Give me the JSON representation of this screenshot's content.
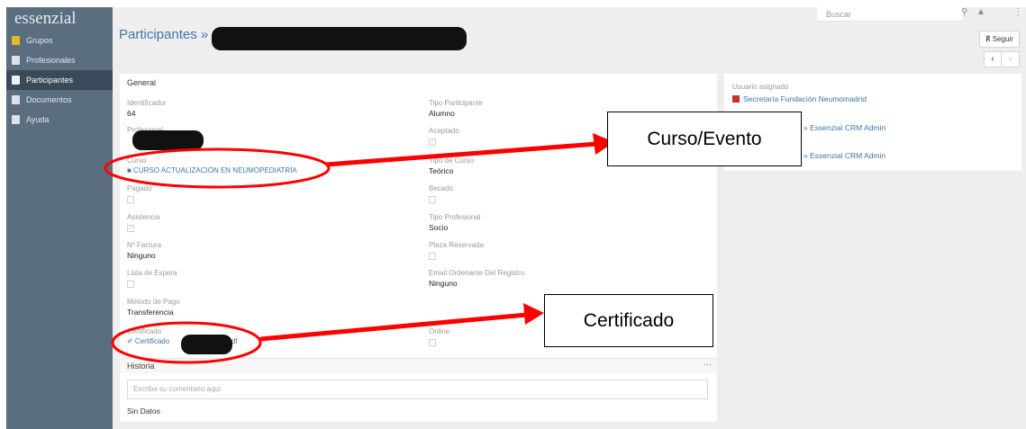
{
  "app": {
    "logo": "essenzial"
  },
  "sidebar": {
    "items": [
      {
        "label": "Grupos"
      },
      {
        "label": "Profesionales"
      },
      {
        "label": "Participantes"
      },
      {
        "label": "Documentos"
      },
      {
        "label": "Ayuda"
      }
    ]
  },
  "topbar": {
    "search_placeholder": "Buscar"
  },
  "header": {
    "title": "Participantes »",
    "follow_label": "℟ Seguir",
    "prev": "‹",
    "next": "›"
  },
  "panel": {
    "section_title": "General",
    "left": {
      "identificador_label": "Identificador",
      "identificador_value": "64",
      "profesional_label": "Profesional",
      "curso_label": "Curso",
      "curso_value": "■ CURSO ACTUALIZACIÓN EN NEUMOPEDIATRÍA",
      "pagado_label": "Pagado",
      "asistencia_label": "Asistencia",
      "factura_label": "Nº Factura",
      "factura_value": "Ninguno",
      "espera_label": "Lista de Espera",
      "pago_label": "Método de Pago",
      "pago_value": "Transferencia",
      "certificado_label": "Certificado",
      "certificado_prefix": "✐ Certificado",
      "certificado_suffix": ".pdf"
    },
    "right": {
      "tipo_part_label": "Tipo Participante",
      "tipo_part_value": "Alumno",
      "aceptado_label": "Aceptado",
      "tipo_curso_label": "Tipo de Curso",
      "tipo_curso_value": "Teórico",
      "becado_label": "Becado",
      "tipo_prof_label": "Tipo Profesional",
      "tipo_prof_value": "Socio",
      "plaza_label": "Plaza Reservada",
      "email_label": "Email Ordenante Del Registro",
      "email_value": "Ninguno",
      "online_label": "Online"
    },
    "historia": {
      "title": "Historia",
      "menu": "···",
      "comment_placeholder": "Escriba su comentario aquí",
      "empty": "Sin Datos"
    }
  },
  "side_panel": {
    "assigned_label": "Usuario asignado",
    "assigned_value": "Secretaría Fundación Neumomadrid",
    "created_value": "» Essenzial CRM Admin",
    "modified_value": "» Essenzial CRM Admin"
  },
  "annotations": {
    "curso_evento": "Curso/Evento",
    "certificado": "Certificado",
    "color": "#ff0000"
  }
}
